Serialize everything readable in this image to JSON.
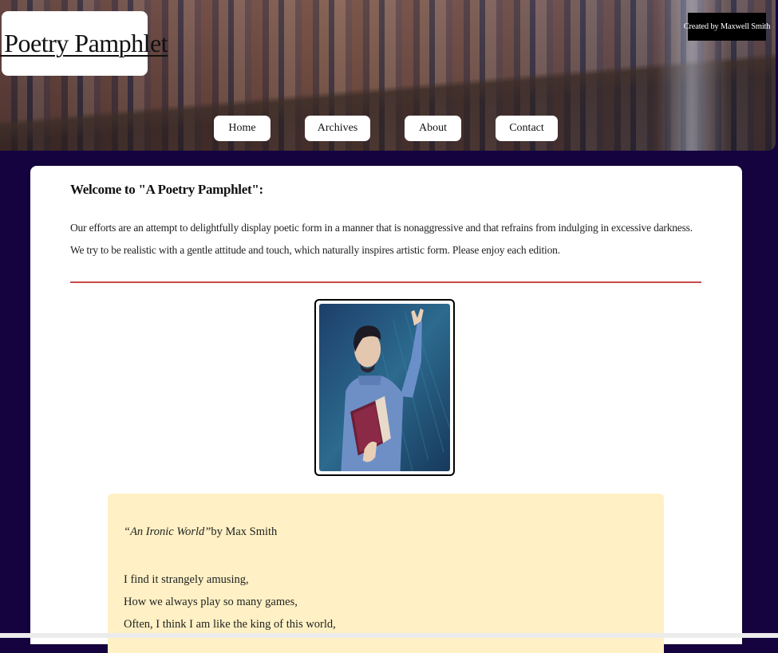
{
  "header": {
    "site_title": "A Poetry Pamphlet",
    "creator_label": "Created by Maxwell Smith",
    "nav": [
      {
        "label": "Home"
      },
      {
        "label": "Archives"
      },
      {
        "label": "About"
      },
      {
        "label": "Contact"
      }
    ]
  },
  "main": {
    "welcome_heading": "Welcome to \"A Poetry Pamphlet\":",
    "intro_text": "Our efforts are an attempt to delightfully display poetic form in a manner that is nonaggressive and that refrains from indulging in excessive darkness. We try to be realistic with a gentle attitude and touch, which naturally inspires artistic form. Please enjoy each edition.",
    "poem": {
      "title": "“An Ironic World”",
      "byline": "by Max Smith",
      "lines": [
        "I find it strangely amusing,",
        "How we always play so many games,",
        "Often, I think I am like the king of this world,"
      ]
    }
  },
  "colors": {
    "page_background": "#150340",
    "divider": "#c74a4a",
    "poem_background": "#fff1c5"
  }
}
